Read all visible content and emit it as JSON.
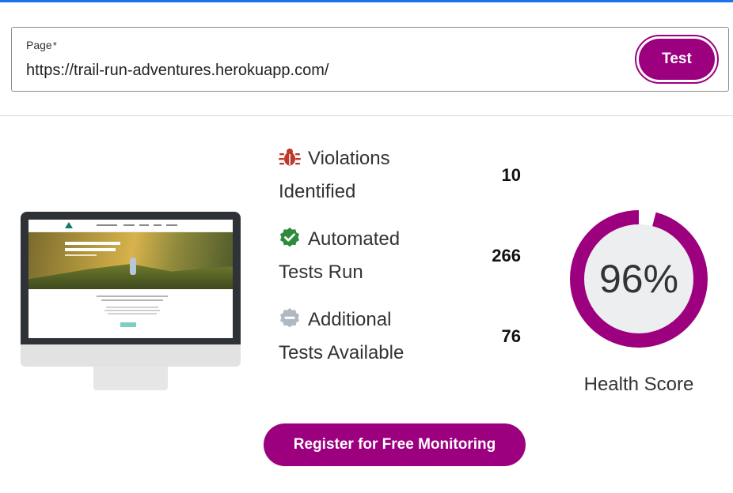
{
  "page_field": {
    "label": "Page",
    "required_marker": "*",
    "value": "https://trail-run-adventures.herokuapp.com/"
  },
  "test_button": {
    "label": "Test"
  },
  "stats": [
    {
      "icon": "bug-icon",
      "label_line1": "Violations",
      "label_line2": "Identified",
      "value": "10",
      "icon_color": "#c0392b"
    },
    {
      "icon": "check-badge-icon",
      "label_line1": "Automated",
      "label_line2": "Tests Run",
      "value": "266",
      "icon_color": "#2e8b3e"
    },
    {
      "icon": "minus-badge-icon",
      "label_line1": "Additional",
      "label_line2": "Tests Available",
      "value": "76",
      "icon_color": "#b0b8c0"
    }
  ],
  "health": {
    "score_text": "96%",
    "score_fraction": 0.96,
    "label": "Health Score"
  },
  "register_button": {
    "label": "Register for Free Monitoring"
  },
  "colors": {
    "brand": "#9c007f",
    "gauge_track": "#ffffff",
    "gauge_inner": "#eceef0",
    "top_accent": "#1a73e8"
  }
}
